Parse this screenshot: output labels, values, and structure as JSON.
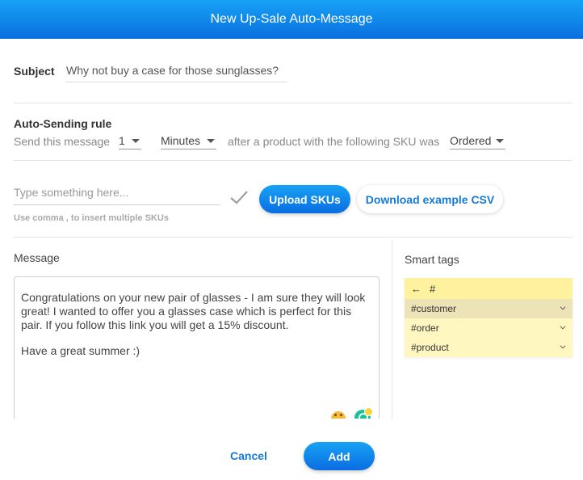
{
  "header": {
    "title": "New Up-Sale Auto-Message"
  },
  "subject": {
    "label": "Subject",
    "value": "Why not buy a case for those sunglasses?"
  },
  "auto_sending": {
    "title": "Auto-Sending rule",
    "prefix": "Send this message",
    "amount": "1",
    "unit": "Minutes",
    "middle": "after a product with the following SKU was",
    "event": "Ordered"
  },
  "sku": {
    "placeholder": "Type something here...",
    "hint": "Use comma , to insert multiple SKUs",
    "upload_label": "Upload SKUs",
    "download_label": "Download example CSV"
  },
  "message": {
    "label": "Message",
    "paragraph1": "Congratulations on your new pair of glasses - I am sure they will look great! I wanted to offer you a glasses case which is perfect for this pair. If you follow this link you will get a 15% discount.",
    "paragraph2": "Have a great summer :)"
  },
  "smart_tags": {
    "label": "Smart tags",
    "back_glyph": "←",
    "search_value": "#",
    "items": [
      "#customer",
      "#order",
      "#product"
    ]
  },
  "footer": {
    "cancel_label": "Cancel",
    "add_label": "Add"
  },
  "colors": {
    "accent": "#0a6fe0",
    "link": "#1579d6",
    "tag_bg": "#fff7bf"
  }
}
